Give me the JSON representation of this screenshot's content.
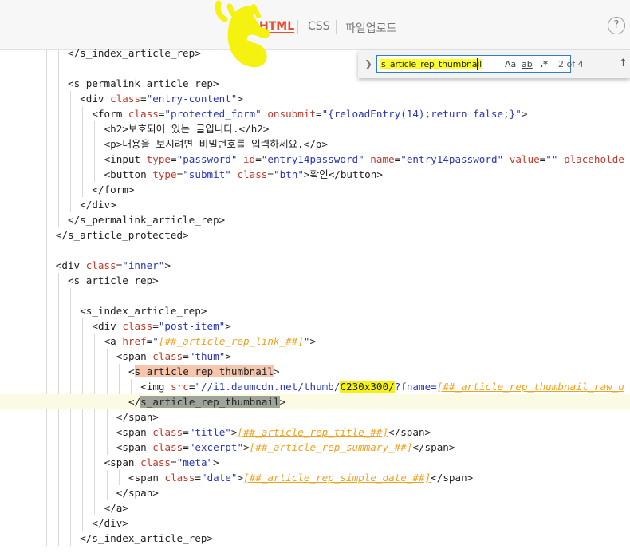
{
  "tabs": [
    {
      "label": "HTML",
      "active": true
    },
    {
      "label": "CSS",
      "active": false
    },
    {
      "label": "파일업로드",
      "active": false
    }
  ],
  "help_label": "?",
  "find": {
    "query": "s_article_rep_thumbnail",
    "match_case_label": "Aa",
    "whole_word_label": "ab",
    "regex_label": ".*",
    "count": "2 of 4"
  },
  "code_lines": [
    {
      "indent": 5,
      "segs": [
        [
          "tag",
          "</s_index_article_rep>"
        ]
      ]
    },
    {
      "indent": 0,
      "segs": []
    },
    {
      "indent": 5,
      "segs": [
        [
          "tag",
          "<s_permalink_article_rep>"
        ]
      ]
    },
    {
      "indent": 7,
      "segs": [
        [
          "tag",
          "<div "
        ],
        [
          "attr",
          "class"
        ],
        [
          "tag",
          "="
        ],
        [
          "str",
          "\"entry-content\""
        ],
        [
          "tag",
          ">"
        ]
      ]
    },
    {
      "indent": 9,
      "segs": [
        [
          "tag",
          "<form "
        ],
        [
          "attr",
          "class"
        ],
        [
          "tag",
          "="
        ],
        [
          "str",
          "\"protected_form\""
        ],
        [
          "tag",
          " "
        ],
        [
          "attr",
          "onsubmit"
        ],
        [
          "tag",
          "="
        ],
        [
          "str",
          "\"{reloadEntry(14);return false;}\""
        ],
        [
          "tag",
          ">"
        ]
      ]
    },
    {
      "indent": 11,
      "segs": [
        [
          "tag",
          "<h2>"
        ],
        [
          "txt",
          "보호되어 있는 글입니다."
        ],
        [
          "tag",
          "</h2>"
        ]
      ]
    },
    {
      "indent": 11,
      "segs": [
        [
          "tag",
          "<p>"
        ],
        [
          "txt",
          "내용을 보시려면 비밀번호를 입력하세요."
        ],
        [
          "tag",
          "</p>"
        ]
      ]
    },
    {
      "indent": 11,
      "segs": [
        [
          "tag",
          "<input "
        ],
        [
          "attr",
          "type"
        ],
        [
          "tag",
          "="
        ],
        [
          "str",
          "\"password\""
        ],
        [
          "tag",
          " "
        ],
        [
          "attr",
          "id"
        ],
        [
          "tag",
          "="
        ],
        [
          "str",
          "\"entry14password\""
        ],
        [
          "tag",
          " "
        ],
        [
          "attr",
          "name"
        ],
        [
          "tag",
          "="
        ],
        [
          "str",
          "\"entry14password\""
        ],
        [
          "tag",
          " "
        ],
        [
          "attr",
          "value"
        ],
        [
          "tag",
          "="
        ],
        [
          "str",
          "\"\""
        ],
        [
          "tag",
          " "
        ],
        [
          "attr",
          "placeholde"
        ]
      ]
    },
    {
      "indent": 11,
      "segs": [
        [
          "tag",
          "<button "
        ],
        [
          "attr",
          "type"
        ],
        [
          "tag",
          "="
        ],
        [
          "str",
          "\"submit\""
        ],
        [
          "tag",
          " "
        ],
        [
          "attr",
          "class"
        ],
        [
          "tag",
          "="
        ],
        [
          "str",
          "\"btn\""
        ],
        [
          "tag",
          ">"
        ],
        [
          "txt",
          "확인"
        ],
        [
          "tag",
          "</button>"
        ]
      ]
    },
    {
      "indent": 9,
      "segs": [
        [
          "tag",
          "</form>"
        ]
      ]
    },
    {
      "indent": 7,
      "segs": [
        [
          "tag",
          "</div>"
        ]
      ]
    },
    {
      "indent": 5,
      "segs": [
        [
          "tag",
          "</s_permalink_article_rep>"
        ]
      ]
    },
    {
      "indent": 3,
      "segs": [
        [
          "tag",
          "</s_article_protected>"
        ]
      ]
    },
    {
      "indent": 0,
      "segs": []
    },
    {
      "indent": 3,
      "segs": [
        [
          "tag",
          "<div "
        ],
        [
          "attr",
          "class"
        ],
        [
          "tag",
          "="
        ],
        [
          "str",
          "\"inner\""
        ],
        [
          "tag",
          ">"
        ]
      ]
    },
    {
      "indent": 5,
      "segs": [
        [
          "tag",
          "<s_article_rep>"
        ]
      ]
    },
    {
      "indent": 0,
      "segs": []
    },
    {
      "indent": 7,
      "segs": [
        [
          "tag",
          "<s_index_article_rep>"
        ]
      ]
    },
    {
      "indent": 9,
      "segs": [
        [
          "tag",
          "<div "
        ],
        [
          "attr",
          "class"
        ],
        [
          "tag",
          "="
        ],
        [
          "str",
          "\"post-item\""
        ],
        [
          "tag",
          ">"
        ]
      ]
    },
    {
      "indent": 11,
      "segs": [
        [
          "tag",
          "<a "
        ],
        [
          "attr",
          "href"
        ],
        [
          "tag",
          "="
        ],
        [
          "str",
          "\""
        ],
        [
          "tpl",
          "[##_article_rep_link_##]"
        ],
        [
          "str",
          "\""
        ],
        [
          "tag",
          ">"
        ]
      ]
    },
    {
      "indent": 13,
      "segs": [
        [
          "tag",
          "<span "
        ],
        [
          "attr",
          "class"
        ],
        [
          "tag",
          "="
        ],
        [
          "str",
          "\"thum\""
        ],
        [
          "tag",
          ">"
        ]
      ]
    },
    {
      "indent": 15,
      "segs": [
        [
          "tag",
          "<"
        ],
        [
          "hl-orange",
          "s_article_rep_thumbnail"
        ],
        [
          "tag",
          ">"
        ]
      ]
    },
    {
      "indent": 17,
      "segs": [
        [
          "tag",
          "<img "
        ],
        [
          "attr",
          "src"
        ],
        [
          "tag",
          "="
        ],
        [
          "str",
          "\"//i1.daumcdn.net/thumb/"
        ],
        [
          "hl-yellow",
          "C230x300/"
        ],
        [
          "str",
          "?fname="
        ],
        [
          "tpl",
          "[##_article_rep_thumbnail_raw_u"
        ]
      ]
    },
    {
      "indent": 15,
      "current": true,
      "segs": [
        [
          "tag",
          "</"
        ],
        [
          "hl-gray",
          "s_article_rep_thumbnail"
        ],
        [
          "tag",
          ">"
        ]
      ]
    },
    {
      "indent": 13,
      "segs": [
        [
          "tag",
          "</span>"
        ]
      ]
    },
    {
      "indent": 13,
      "segs": [
        [
          "tag",
          "<span "
        ],
        [
          "attr",
          "class"
        ],
        [
          "tag",
          "="
        ],
        [
          "str",
          "\"title\""
        ],
        [
          "tag",
          ">"
        ],
        [
          "tpl",
          "[##_article_rep_title_##]"
        ],
        [
          "tag",
          "</span>"
        ]
      ]
    },
    {
      "indent": 13,
      "segs": [
        [
          "tag",
          "<span "
        ],
        [
          "attr",
          "class"
        ],
        [
          "tag",
          "="
        ],
        [
          "str",
          "\"excerpt\""
        ],
        [
          "tag",
          ">"
        ],
        [
          "tpl",
          "[##_article_rep_summary_##]"
        ],
        [
          "tag",
          "</span>"
        ]
      ]
    },
    {
      "indent": 11,
      "segs": [
        [
          "tag",
          "<span "
        ],
        [
          "attr",
          "class"
        ],
        [
          "tag",
          "="
        ],
        [
          "str",
          "\"meta\""
        ],
        [
          "tag",
          ">"
        ]
      ]
    },
    {
      "indent": 15,
      "segs": [
        [
          "tag",
          "<span "
        ],
        [
          "attr",
          "class"
        ],
        [
          "tag",
          "="
        ],
        [
          "str",
          "\"date\""
        ],
        [
          "tag",
          ">"
        ],
        [
          "tpl",
          "[##_article_rep_simple_date_##]"
        ],
        [
          "tag",
          "</span>"
        ]
      ]
    },
    {
      "indent": 13,
      "segs": [
        [
          "tag",
          "</span>"
        ]
      ]
    },
    {
      "indent": 11,
      "segs": [
        [
          "tag",
          "</a>"
        ]
      ]
    },
    {
      "indent": 9,
      "segs": [
        [
          "tag",
          "</div>"
        ]
      ]
    },
    {
      "indent": 7,
      "segs": [
        [
          "tag",
          "</s_index_article_rep>"
        ]
      ]
    }
  ]
}
